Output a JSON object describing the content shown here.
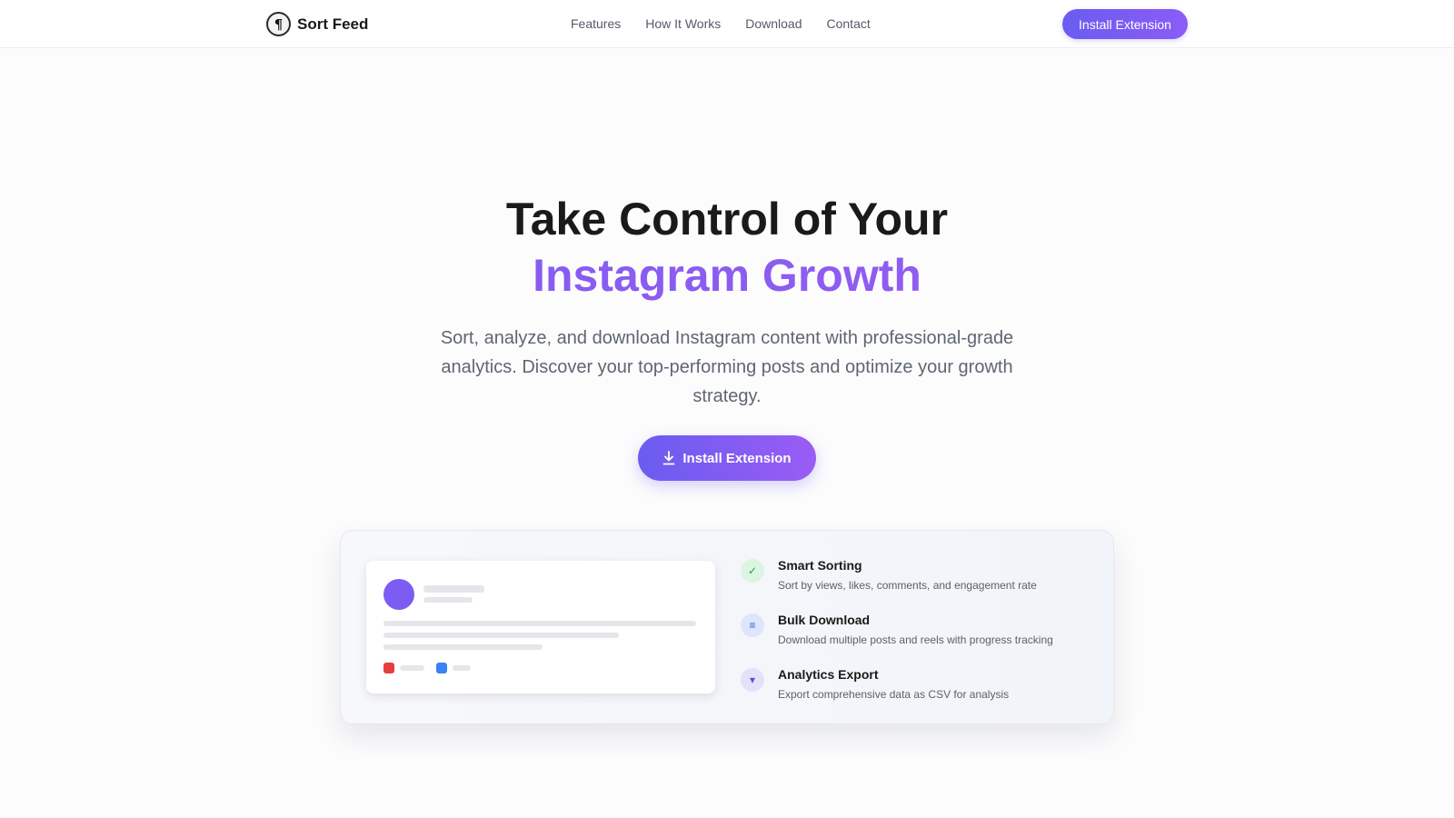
{
  "nav": {
    "brand_glyph": "¶",
    "brand_name": "Sort Feed",
    "links": [
      "Features",
      "How It Works",
      "Download",
      "Contact"
    ],
    "cta": "Install Extension"
  },
  "hero": {
    "title_line1": "Take Control of Your",
    "title_line2": "Instagram Growth",
    "subtitle": "Sort, analyze, and download Instagram content with professional-grade analytics. Discover your top-performing posts and optimize your growth strategy.",
    "cta": "Install Extension"
  },
  "features": [
    {
      "title": "Smart Sorting",
      "desc": "Sort by views, likes, comments, and engagement rate",
      "icon": "check-icon",
      "icon_glyph": "✓",
      "icon_bg": "#dcf5e3",
      "icon_color": "#1f9d4d"
    },
    {
      "title": "Bulk Download",
      "desc": "Download multiple posts and reels with progress tracking",
      "icon": "list-icon",
      "icon_glyph": "≡",
      "icon_bg": "#dde6fb",
      "icon_color": "#3b5bdb"
    },
    {
      "title": "Analytics Export",
      "desc": "Export comprehensive data as CSV for analysis",
      "icon": "chart-export-icon",
      "icon_glyph": "▾",
      "icon_bg": "#e4e2fb",
      "icon_color": "#5b4fd8"
    }
  ],
  "colors": {
    "accent": "#7c5cf2",
    "mock_red": "#e53e3e",
    "mock_blue": "#3b82f6"
  }
}
